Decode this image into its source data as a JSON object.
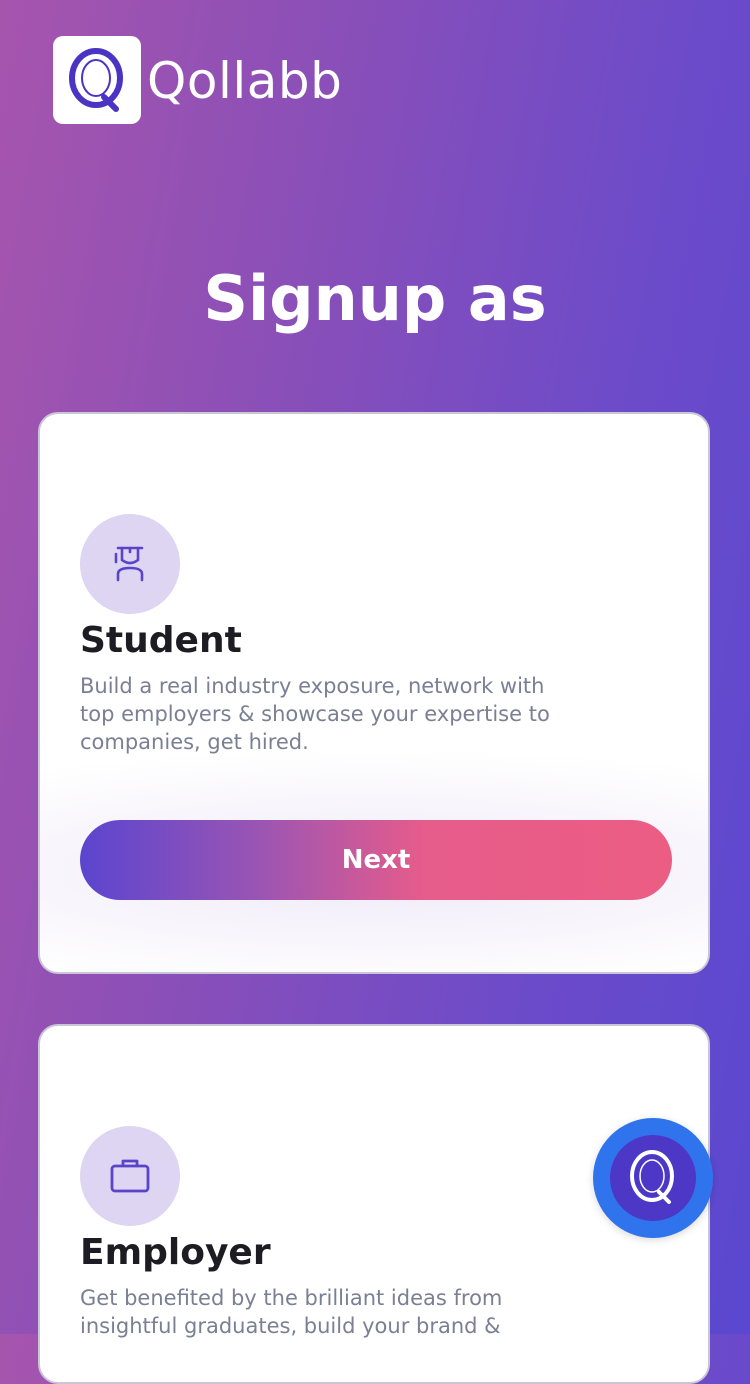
{
  "brand": {
    "name": "Qollabb"
  },
  "heading": "Signup as",
  "cards": [
    {
      "title": "Student",
      "description": "Build a real industry exposure, network with top employers & showcase your expertise to companies, get hired.",
      "icon": "student-icon",
      "button_label": "Next"
    },
    {
      "title": "Employer",
      "description": "Get benefited by the brilliant ideas from insightful graduates, build your brand &",
      "icon": "briefcase-icon"
    }
  ],
  "fab": {
    "icon": "qollabb-logo-icon"
  },
  "colors": {
    "accent_purple": "#5b45cf",
    "accent_pink": "#ec5d83",
    "fab_blue": "#2f74ec",
    "icon_circle": "#ddd5f2"
  }
}
